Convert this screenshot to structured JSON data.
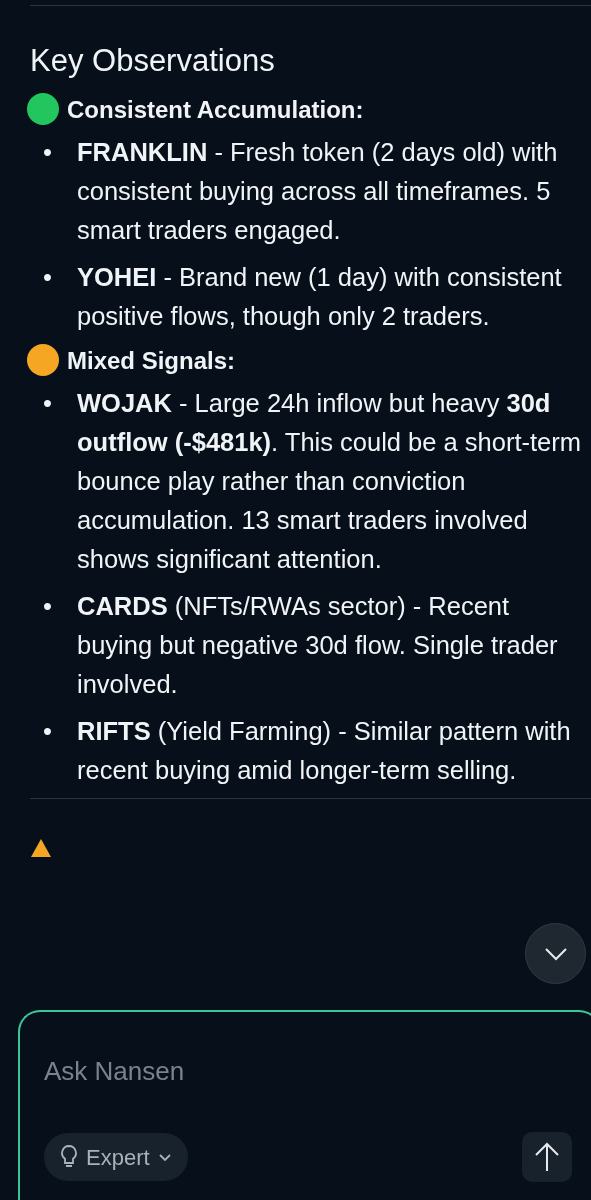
{
  "heading": "Key Observations",
  "sections": [
    {
      "title": "Consistent Accumulation:",
      "color": "#22c55e",
      "items": [
        {
          "marker": "•",
          "text": "**FRANKLIN** - Fresh token (2 days old) with consistent buying across all timeframes. 5 smart traders engaged."
        },
        {
          "marker": "•",
          "text": "**YOHEI** - Brand new (1 day) with consistent positive flows, though only 2 traders."
        }
      ]
    },
    {
      "title": "Mixed Signals:",
      "color": "#f5a623",
      "items": [
        {
          "marker": "•",
          "text": "**WOJAK** - Large 24h inflow but heavy **30d outflow (-$481k)**. This could be a short-term bounce play rather than conviction accumulation. 13 smart traders involved shows significant attention."
        },
        {
          "marker": "•",
          "text": "**CARDS** (NFTs/RWAs sector) - Recent buying but negative 30d flow. Single trader involved."
        },
        {
          "marker": "•",
          "text": "**RIFTS** (Yield Farming) - Similar pattern with recent buying amid longer-term selling."
        }
      ]
    }
  ],
  "composer": {
    "placeholder": "Ask Nansen",
    "mode": "Expert"
  }
}
